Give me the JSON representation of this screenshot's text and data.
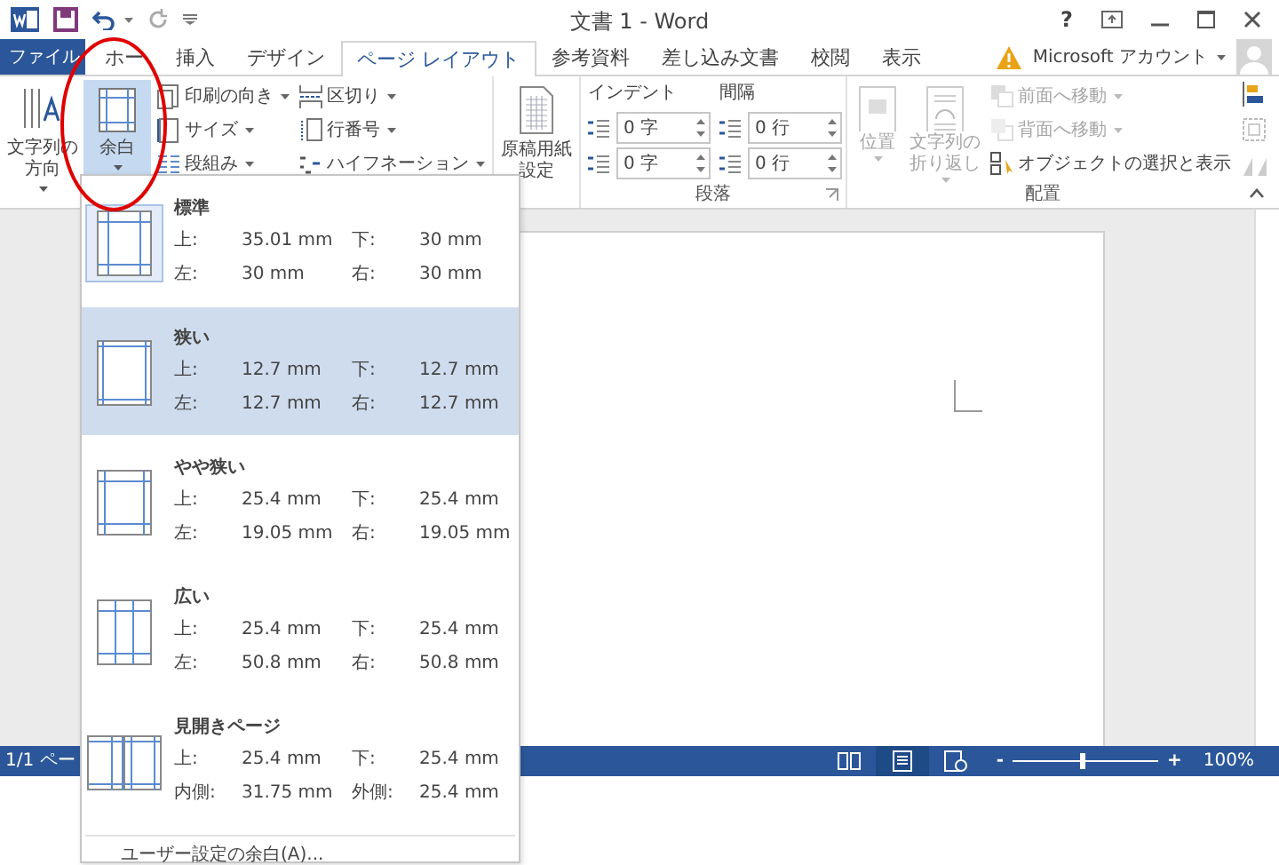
{
  "title_bar": {
    "title": "文書 1 - Word",
    "help": "?"
  },
  "tabs": [
    {
      "label": "ファイル",
      "kind": "file",
      "selected": false
    },
    {
      "label": "ホー",
      "kind": "tab",
      "selected": false
    },
    {
      "label": "挿入",
      "kind": "tab",
      "selected": false
    },
    {
      "label": "デザイン",
      "kind": "tab",
      "selected": false
    },
    {
      "label": "ページ レイアウト",
      "kind": "tab",
      "selected": true
    },
    {
      "label": "参考資料",
      "kind": "tab",
      "selected": false
    },
    {
      "label": "差し込み文書",
      "kind": "tab",
      "selected": false
    },
    {
      "label": "校閲",
      "kind": "tab",
      "selected": false
    },
    {
      "label": "表示",
      "kind": "tab",
      "selected": false
    }
  ],
  "account": {
    "label": "Microsoft アカウント"
  },
  "ribbon": {
    "page_setup": {
      "large": [
        {
          "label": "文字列の方向",
          "kind": "text-direction",
          "pressed": false
        },
        {
          "label": "余白",
          "kind": "margins",
          "pressed": true
        }
      ],
      "small": [
        {
          "label": "印刷の向き",
          "kind": "orientation",
          "dropdown": true
        },
        {
          "label": "サイズ",
          "kind": "size",
          "dropdown": true
        },
        {
          "label": "段組み",
          "kind": "columns",
          "dropdown": true
        },
        {
          "label": "区切り",
          "kind": "breaks",
          "dropdown": true
        },
        {
          "label": "行番号",
          "kind": "line-numbers",
          "dropdown": true
        },
        {
          "label": "ハイフネーション",
          "kind": "hyphenation",
          "dropdown": true
        }
      ]
    },
    "manuscript": {
      "label": "原稿用紙設定"
    },
    "paragraph": {
      "title": "段落",
      "indent_label": "インデント",
      "spacing_label": "間隔",
      "indent": [
        "0 字",
        "0 字"
      ],
      "spacing": [
        "0 行",
        "0 行"
      ]
    },
    "arrange": {
      "title": "配置",
      "large": [
        {
          "label": "位置",
          "kind": "position",
          "disabled": true,
          "dropdown": true
        },
        {
          "label": "文字列の折り返し",
          "kind": "wrap",
          "disabled": true,
          "dropdown": true
        }
      ],
      "small": [
        {
          "label": "前面へ移動",
          "kind": "forward",
          "disabled": true,
          "dropdown": true
        },
        {
          "label": "背面へ移動",
          "kind": "backward",
          "disabled": true,
          "dropdown": true
        },
        {
          "label": "オブジェクトの選択と表示",
          "kind": "selection",
          "disabled": false,
          "dropdown": false
        }
      ]
    }
  },
  "margins_menu": {
    "items": [
      {
        "name": "標準",
        "kind": "normal",
        "selected": false,
        "current": true,
        "rows": [
          [
            "上:",
            "35.01 mm",
            "下:",
            "30 mm"
          ],
          [
            "左:",
            "30 mm",
            "右:",
            "30 mm"
          ]
        ]
      },
      {
        "name": "狭い",
        "kind": "narrow",
        "selected": true,
        "current": false,
        "rows": [
          [
            "上:",
            "12.7 mm",
            "下:",
            "12.7 mm"
          ],
          [
            "左:",
            "12.7 mm",
            "右:",
            "12.7 mm"
          ]
        ]
      },
      {
        "name": "やや狭い",
        "kind": "moderate",
        "selected": false,
        "current": false,
        "rows": [
          [
            "上:",
            "25.4 mm",
            "下:",
            "25.4 mm"
          ],
          [
            "左:",
            "19.05 mm",
            "右:",
            "19.05 mm"
          ]
        ]
      },
      {
        "name": "広い",
        "kind": "wide",
        "selected": false,
        "current": false,
        "rows": [
          [
            "上:",
            "25.4 mm",
            "下:",
            "25.4 mm"
          ],
          [
            "左:",
            "50.8 mm",
            "右:",
            "50.8 mm"
          ]
        ]
      },
      {
        "name": "見開きページ",
        "kind": "mirrored",
        "selected": false,
        "current": false,
        "rows": [
          [
            "上:",
            "25.4 mm",
            "下:",
            "25.4 mm"
          ],
          [
            "内側:",
            "31.75 mm",
            "外側:",
            "25.4 mm"
          ]
        ]
      }
    ],
    "footer": "ユーザー設定の余白(A)..."
  },
  "status_bar": {
    "page": "1/1 ペー",
    "views": [
      {
        "kind": "read",
        "selected": false
      },
      {
        "kind": "print",
        "selected": true
      },
      {
        "kind": "web",
        "selected": false
      }
    ],
    "zoom_out": "-",
    "zoom_in": "+",
    "zoom": {
      "level": 0.48
    },
    "zoom_percent": "100%"
  }
}
